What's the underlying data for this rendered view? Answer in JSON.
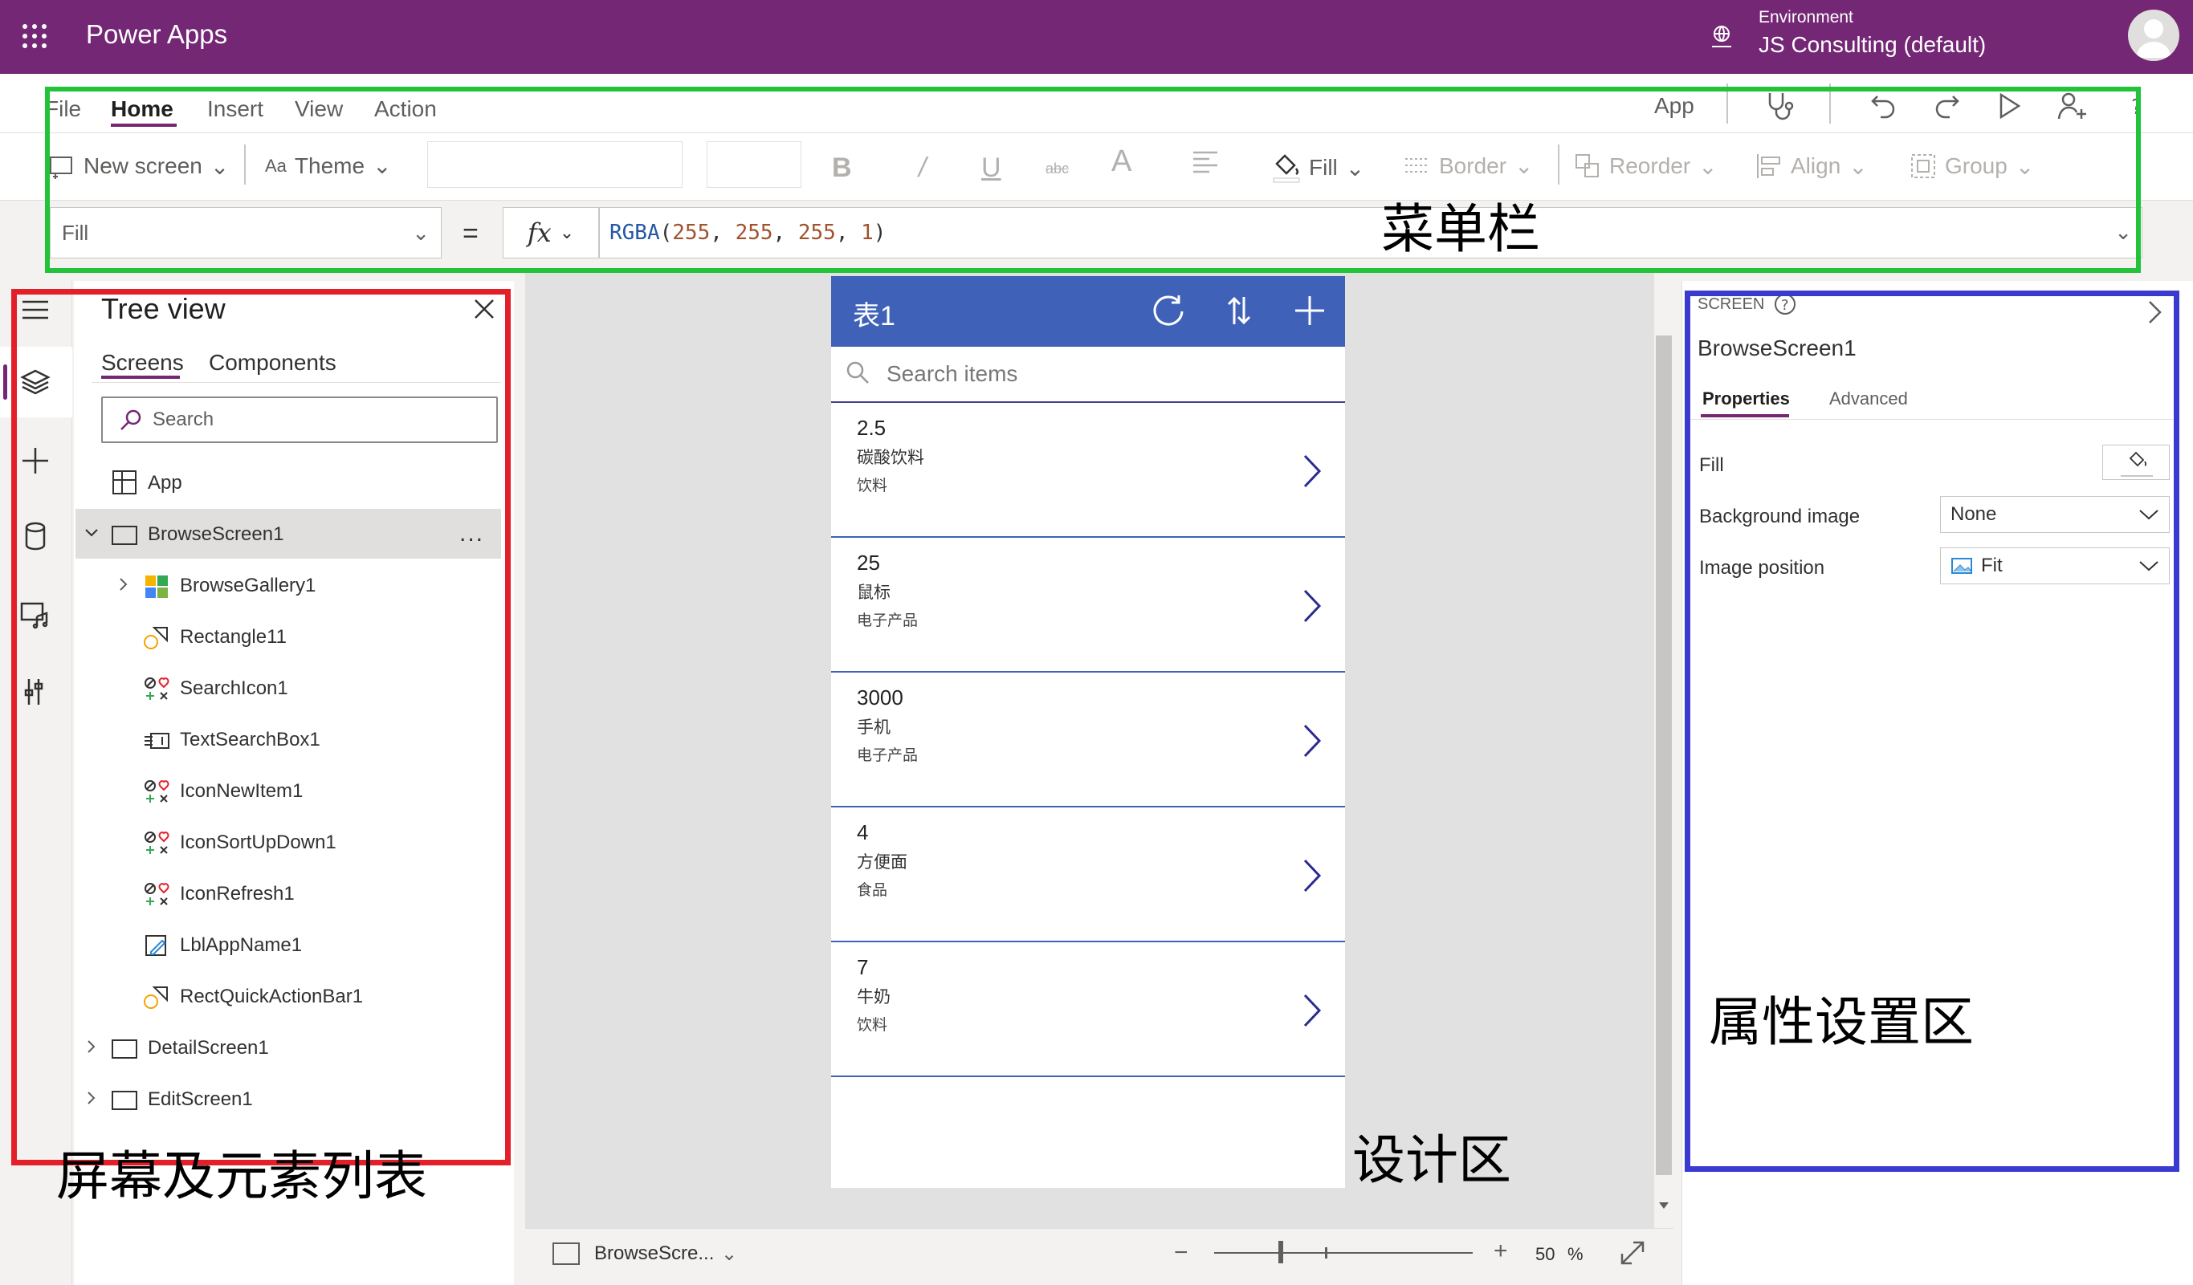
{
  "topbar": {
    "app_title": "Power Apps",
    "env_label": "Environment",
    "env_value": "JS Consulting (default)"
  },
  "menu": {
    "tabs": [
      "File",
      "Home",
      "Insert",
      "View",
      "Action"
    ],
    "active_tab": "Home",
    "app_label": "App"
  },
  "toolbar": {
    "new_screen": "New screen",
    "theme": "Theme",
    "fill": "Fill",
    "border": "Border",
    "reorder": "Reorder",
    "align": "Align",
    "group": "Group"
  },
  "formula": {
    "property": "Fill",
    "equals": "=",
    "fx": "fx",
    "fn": "RGBA",
    "open": "(",
    "a1": "255",
    "a2": "255",
    "a3": "255",
    "a4": "1",
    "sep": ", ",
    "close": ")"
  },
  "tree": {
    "title": "Tree view",
    "tabs": [
      "Screens",
      "Components"
    ],
    "search_placeholder": "Search",
    "items": [
      {
        "label": "App",
        "icon": "app-icon"
      },
      {
        "label": "BrowseScreen1",
        "icon": "screen-icon",
        "selected": true
      },
      {
        "label": "BrowseGallery1",
        "icon": "gallery-icon"
      },
      {
        "label": "Rectangle11",
        "icon": "shape-icon"
      },
      {
        "label": "SearchIcon1",
        "icon": "icons-icon"
      },
      {
        "label": "TextSearchBox1",
        "icon": "textinput-icon"
      },
      {
        "label": "IconNewItem1",
        "icon": "icons-icon"
      },
      {
        "label": "IconSortUpDown1",
        "icon": "icons-icon"
      },
      {
        "label": "IconRefresh1",
        "icon": "icons-icon"
      },
      {
        "label": "LblAppName1",
        "icon": "label-icon"
      },
      {
        "label": "RectQuickActionBar1",
        "icon": "shape-icon"
      },
      {
        "label": "DetailScreen1",
        "icon": "screen-icon"
      },
      {
        "label": "EditScreen1",
        "icon": "screen-icon"
      }
    ],
    "more": "..."
  },
  "phone": {
    "title": "表1",
    "search_placeholder": "Search items",
    "items": [
      {
        "title": "2.5",
        "subtitle": "碳酸饮料",
        "body": "饮料"
      },
      {
        "title": "25",
        "subtitle": "鼠标",
        "body": "电子产品"
      },
      {
        "title": "3000",
        "subtitle": "手机",
        "body": "电子产品"
      },
      {
        "title": "4",
        "subtitle": "方便面",
        "body": "食品"
      },
      {
        "title": "7",
        "subtitle": "牛奶",
        "body": "饮料"
      }
    ]
  },
  "status": {
    "screen_name": "BrowseScre...",
    "zoom": "50",
    "zoom_unit": "%"
  },
  "properties": {
    "kind": "SCREEN",
    "name": "BrowseScreen1",
    "tabs": [
      "Properties",
      "Advanced"
    ],
    "fill_label": "Fill",
    "bg_image_label": "Background image",
    "bg_image_value": "None",
    "image_pos_label": "Image position",
    "image_pos_value": "Fit"
  },
  "annotations": {
    "menu_bar": "菜单栏",
    "element_list": "屏幕及元素列表",
    "design_area": "设计区",
    "props_area": "属性设置区",
    "colors": {
      "menu_bar": "#22c33a",
      "element_list": "#e3202a",
      "props_area": "#3a3ad0"
    }
  },
  "colors": {
    "brand": "#742774",
    "phone_header": "#3f62b8"
  }
}
